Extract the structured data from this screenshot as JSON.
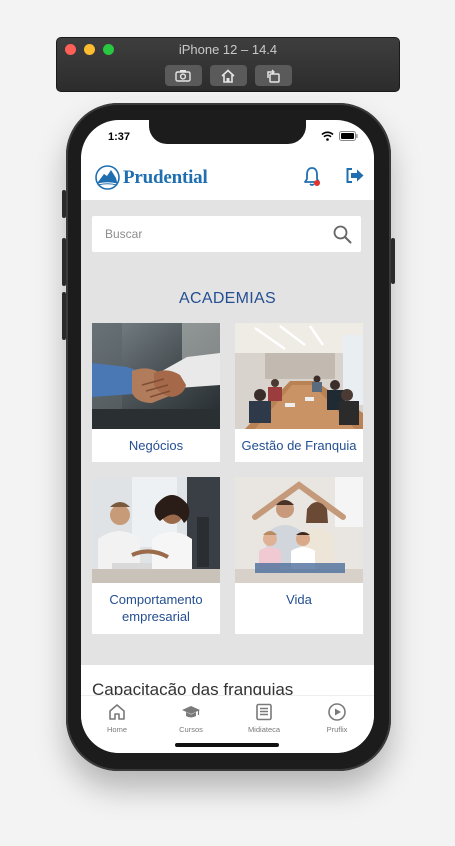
{
  "simulator": {
    "title": "iPhone 12 – 14.4",
    "buttons": [
      "screenshot-icon",
      "home-icon",
      "rotate-icon"
    ]
  },
  "status_bar": {
    "time": "1:37"
  },
  "header": {
    "brand": "Prudential",
    "icons": [
      "bell-icon",
      "logout-icon"
    ],
    "accent_color": "#1f6fb0",
    "badge_color": "#e2332d"
  },
  "search": {
    "placeholder": "Buscar"
  },
  "academias": {
    "title": "ACADEMIAS",
    "cards": [
      {
        "label": "Negócios"
      },
      {
        "label": "Gestão de Franquia"
      },
      {
        "label": "Comportamento empresarial"
      },
      {
        "label": "Vida"
      }
    ]
  },
  "section2": {
    "title": "Capacitação das franquias"
  },
  "tabs": [
    {
      "label": "Home",
      "icon": "home-icon"
    },
    {
      "label": "Cursos",
      "icon": "graduation-cap-icon"
    },
    {
      "label": "Midiateca",
      "icon": "document-icon"
    },
    {
      "label": "Pruflix",
      "icon": "play-icon"
    }
  ],
  "colors": {
    "title_blue": "#244f92",
    "background_gray": "#e3e3e3"
  }
}
